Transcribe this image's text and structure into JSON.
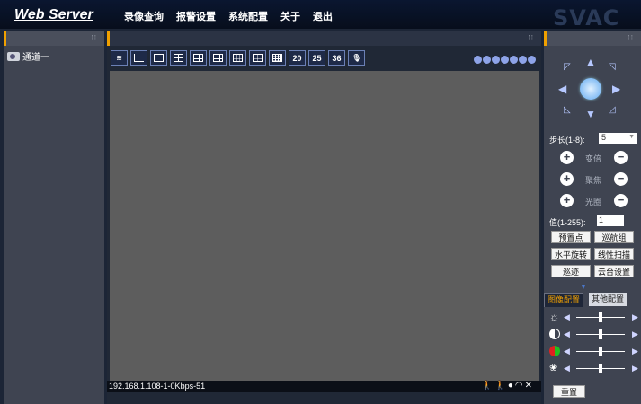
{
  "header": {
    "logo": "Web Server",
    "nav": [
      "录像查询",
      "报警设置",
      "系统配置",
      "关于",
      "退出"
    ],
    "brand": "SVAC"
  },
  "left": {
    "channel": "通道一"
  },
  "toolbar": {
    "layouts": [
      "20",
      "25",
      "36"
    ]
  },
  "status": {
    "text": "192.168.1.108-1-0Kbps-51",
    "icons": [
      "person-icon",
      "person-alarm-icon",
      "record-dot-icon",
      "headphone-icon",
      "close-icon"
    ]
  },
  "ptz": {
    "step_label": "步长(1-8):",
    "step_value": "5",
    "zoom_label": "变倍",
    "focus_label": "聚焦",
    "iris_label": "光圈",
    "value_label": "值(1-255):",
    "value": "1",
    "buttons": [
      "预置点",
      "巡航组",
      "水平旋转",
      "线性扫描",
      "巡迹",
      "云台设置"
    ]
  },
  "image": {
    "tab_active": "图像配置",
    "tab_other": "其他配置",
    "brightness": 0.5,
    "contrast": 0.5,
    "saturation": 0.5,
    "hue": 0.5,
    "reset": "重置"
  }
}
